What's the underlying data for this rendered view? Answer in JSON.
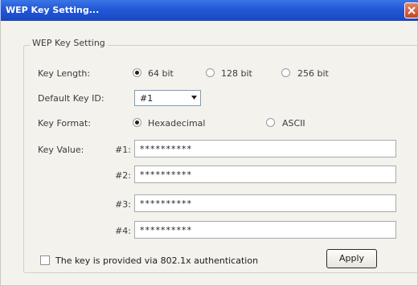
{
  "window": {
    "title": "WEP Key Setting..."
  },
  "group": {
    "legend": "WEP Key Setting"
  },
  "key_length": {
    "label": "Key Length:",
    "options": [
      {
        "label": "64 bit",
        "checked": true
      },
      {
        "label": "128 bit",
        "checked": false
      },
      {
        "label": "256 bit",
        "checked": false
      }
    ]
  },
  "default_key_id": {
    "label": "Default Key ID:",
    "value": "#1"
  },
  "key_format": {
    "label": "Key Format:",
    "options": [
      {
        "label": "Hexadecimal",
        "checked": true
      },
      {
        "label": "ASCII",
        "checked": false
      }
    ]
  },
  "key_value": {
    "label": "Key Value:",
    "keys": [
      {
        "id": "#1:",
        "value": "**********"
      },
      {
        "id": "#2:",
        "value": "**********"
      },
      {
        "id": "#3:",
        "value": "**********"
      },
      {
        "id": "#4:",
        "value": "**********"
      }
    ]
  },
  "auth_checkbox": {
    "label": "The key is provided via 802.1x authentication",
    "checked": false
  },
  "buttons": {
    "apply": "Apply"
  },
  "colors": {
    "titlebar": "#2258d6",
    "close_button": "#c44623",
    "background": "#f3f2ec"
  }
}
